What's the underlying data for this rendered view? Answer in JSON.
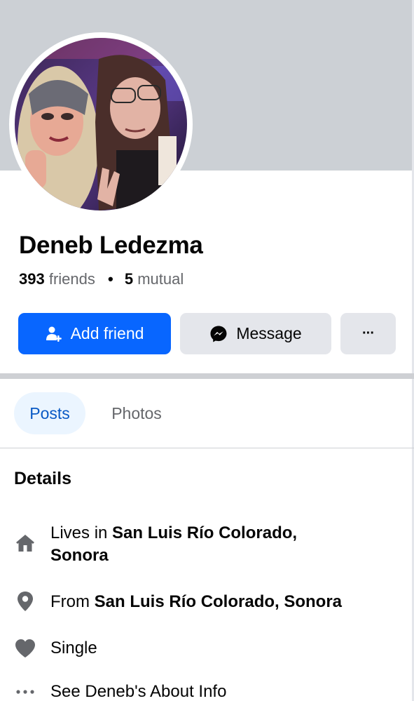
{
  "profile": {
    "name": "Deneb Ledezma",
    "friends_count": "393",
    "friends_label": "friends",
    "separator": "•",
    "mutual_count": "5",
    "mutual_label": "mutual"
  },
  "actions": {
    "add_friend_label": "Add friend",
    "message_label": "Message",
    "more_label": "···"
  },
  "tabs": [
    {
      "label": "Posts",
      "selected": true
    },
    {
      "label": "Photos",
      "selected": false
    }
  ],
  "details": {
    "title": "Details",
    "items": [
      {
        "icon": "home-icon",
        "prefix": "Lives in",
        "value_line1": "San Luis Río Colorado,",
        "value_line2": "Sonora"
      },
      {
        "icon": "location-pin-icon",
        "prefix": "From",
        "value": "San Luis Río Colorado, Sonora"
      },
      {
        "icon": "heart-icon",
        "text": "Single"
      },
      {
        "icon": "more-dots-icon",
        "text": "See Deneb's About Info"
      }
    ]
  },
  "colors": {
    "accent": "#0866ff",
    "cover": "#ccd0d5",
    "tab_active_bg": "#ebf5ff",
    "tab_active_text": "#0a5ac5",
    "secondary_text": "#65676b",
    "button_gray": "#e4e6eb"
  }
}
